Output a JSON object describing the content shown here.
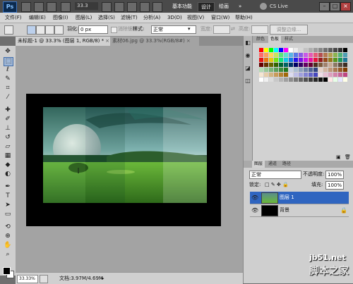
{
  "appbar": {
    "logo": "Ps",
    "zoom": "33.3",
    "workspaces": [
      "基本功能",
      "设计",
      "绘画"
    ],
    "cs_live": "CS Live"
  },
  "menu": [
    "文件(F)",
    "编辑(E)",
    "图像(I)",
    "图层(L)",
    "选择(S)",
    "滤镜(T)",
    "分析(A)",
    "3D(D)",
    "视图(V)",
    "窗口(W)",
    "帮助(H)"
  ],
  "options": {
    "feather_label": "羽化:",
    "feather_value": "0 px",
    "antialias_label": "消除锯齿",
    "style_label": "样式:",
    "style_value": "正常",
    "width_label": "宽度:",
    "height_label": "高度:",
    "refine_label": "调整边缘..."
  },
  "tabs": [
    {
      "label": "未标题-1 @ 33.3% (图层 1, RGB/8) *",
      "close": "×"
    },
    {
      "label": "素材06.jpg @ 33.3%(RGB/8#)",
      "close": "×"
    }
  ],
  "swatches_panel": {
    "tabs": [
      "颜色",
      "色板",
      "样式"
    ],
    "colors": [
      "#ff0000",
      "#ffff00",
      "#00ff00",
      "#00ffff",
      "#0000ff",
      "#ff00ff",
      "#ffffff",
      "#ebebeb",
      "#d6d6d6",
      "#c2c2c2",
      "#adadad",
      "#999999",
      "#858585",
      "#707070",
      "#5c5c5c",
      "#474747",
      "#333333",
      "#000000",
      "#ff6b6b",
      "#ff9c5a",
      "#ffd45a",
      "#c8e65a",
      "#5ae67a",
      "#5ae6c8",
      "#5ab4e6",
      "#5a78e6",
      "#8c5ae6",
      "#c85ae6",
      "#e65ab4",
      "#e65a78",
      "#b45050",
      "#b47850",
      "#b4a050",
      "#8cb450",
      "#50b478",
      "#50a0b4",
      "#e61414",
      "#e67814",
      "#e6c814",
      "#78e614",
      "#14e678",
      "#14c8e6",
      "#1478e6",
      "#2814e6",
      "#7814e6",
      "#c814e6",
      "#e614a0",
      "#e6143c",
      "#961e1e",
      "#964b1e",
      "#96781e",
      "#5a961e",
      "#1e965a",
      "#1e7896",
      "#640000",
      "#643200",
      "#646400",
      "#326400",
      "#006432",
      "#006464",
      "#003264",
      "#000064",
      "#320064",
      "#640064",
      "#640032",
      "#4b2d1e",
      "#7d5a3c",
      "#a0826e",
      "#c8aa96",
      "#8c7864",
      "#5a4b3c",
      "#3c2d23",
      "#b4dcb4",
      "#96c896",
      "#78b478",
      "#5aa05a",
      "#3c8c3c",
      "#1e781e",
      "#c8d2e6",
      "#aabed2",
      "#8ca0be",
      "#6e82aa",
      "#506496",
      "#324682",
      "#e6d2c8",
      "#d2b4a0",
      "#be9678",
      "#aa7850",
      "#965a28",
      "#823c00",
      "#f5e6d2",
      "#e6cdaa",
      "#d2b482",
      "#c89b5a",
      "#b48232",
      "#a0690a",
      "#dcdcf0",
      "#bebee6",
      "#a0a0dc",
      "#8282d2",
      "#6464c8",
      "#4646be",
      "#f0dce6",
      "#e6bed2",
      "#dca0be",
      "#d282aa",
      "#c86496",
      "#be4682",
      "#ffffff",
      "#f0f0f0",
      "#dcdcdc",
      "#c8c8c8",
      "#b4b4b4",
      "#a0a0a0",
      "#8c8c8c",
      "#787878",
      "#646464",
      "#505050",
      "#3c3c3c",
      "#282828",
      "#141414",
      "#000000",
      "#ffe6e6",
      "#e6ffe6",
      "#e6e6ff",
      "#ffffe6"
    ]
  },
  "layers_panel": {
    "tabs": [
      "图层",
      "通道",
      "路径"
    ],
    "blend_mode": "正常",
    "opacity_label": "不透明度:",
    "opacity_value": "100%",
    "lock_label": "锁定:",
    "fill_label": "填充:",
    "fill_value": "100%",
    "layers": [
      {
        "name": "图层 1",
        "selected": true,
        "locked": false
      },
      {
        "name": "背景",
        "selected": false,
        "locked": true
      }
    ]
  },
  "status": {
    "zoom": "33.33%",
    "doc_info": "文档:3.97M/4.69M"
  },
  "watermark": {
    "line1": "jb51.net",
    "line2": "脚本之家"
  },
  "colors": {
    "accent": "#2f65c0",
    "canvas_bg": "#a3a3a3",
    "doc_bg": "#000000"
  }
}
